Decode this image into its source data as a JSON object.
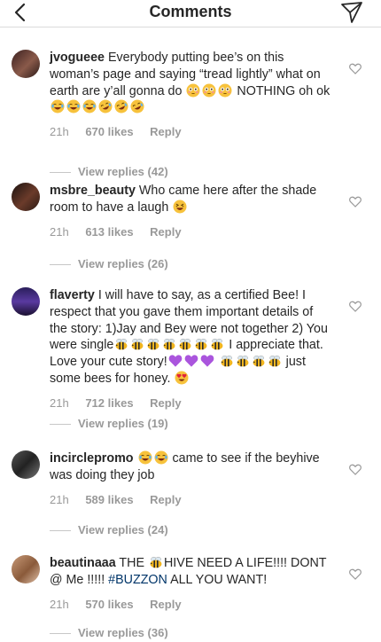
{
  "header": {
    "title": "Comments"
  },
  "comments": [
    {
      "username": "jvogueee",
      "segments": [
        {
          "t": "text",
          "v": " Everybody putting bee’s on this woman’s page and saying “tread lightly” what on earth are y’all gonna do "
        },
        {
          "t": "emoji",
          "v": "flushed"
        },
        {
          "t": "emoji",
          "v": "flushed"
        },
        {
          "t": "emoji",
          "v": "flushed"
        },
        {
          "t": "text",
          "v": " NOTHING oh ok "
        },
        {
          "t": "emoji",
          "v": "joy"
        },
        {
          "t": "emoji",
          "v": "joy"
        },
        {
          "t": "emoji",
          "v": "joy"
        },
        {
          "t": "emoji",
          "v": "rofl"
        },
        {
          "t": "emoji",
          "v": "rofl"
        },
        {
          "t": "emoji",
          "v": "rofl"
        }
      ],
      "time": "21h",
      "likes": "670 likes",
      "reply": "Reply",
      "view_replies": "View replies (42)"
    },
    {
      "username": "msbre_beauty",
      "segments": [
        {
          "t": "text",
          "v": " Who came here after the shade room to have a laugh "
        },
        {
          "t": "emoji",
          "v": "laughing"
        }
      ],
      "time": "21h",
      "likes": "613 likes",
      "reply": "Reply",
      "view_replies": "View replies (26)"
    },
    {
      "username": "flaverty",
      "segments": [
        {
          "t": "text",
          "v": " I will have to say, as a certified Bee! I respect that you gave them important details of the story: 1)Jay and Bey were not together 2) You were single"
        },
        {
          "t": "emoji",
          "v": "bee"
        },
        {
          "t": "emoji",
          "v": "bee"
        },
        {
          "t": "emoji",
          "v": "bee"
        },
        {
          "t": "emoji",
          "v": "bee"
        },
        {
          "t": "emoji",
          "v": "bee"
        },
        {
          "t": "emoji",
          "v": "bee"
        },
        {
          "t": "emoji",
          "v": "bee"
        },
        {
          "t": "text",
          "v": " I appreciate that. Love your cute story!"
        },
        {
          "t": "emoji",
          "v": "purple-heart"
        },
        {
          "t": "emoji",
          "v": "purple-heart"
        },
        {
          "t": "emoji",
          "v": "purple-heart"
        },
        {
          "t": "text",
          "v": " "
        },
        {
          "t": "emoji",
          "v": "bee"
        },
        {
          "t": "emoji",
          "v": "bee"
        },
        {
          "t": "emoji",
          "v": "bee"
        },
        {
          "t": "emoji",
          "v": "bee"
        },
        {
          "t": "text",
          "v": " just some bees for honey. "
        },
        {
          "t": "emoji",
          "v": "heart-eyes"
        }
      ],
      "time": "21h",
      "likes": "712 likes",
      "reply": "Reply",
      "view_replies": "View replies (19)"
    },
    {
      "username": "incirclepromo",
      "segments": [
        {
          "t": "text",
          "v": " "
        },
        {
          "t": "emoji",
          "v": "joy"
        },
        {
          "t": "emoji",
          "v": "joy"
        },
        {
          "t": "text",
          "v": " came to see if the beyhive was doing they job"
        }
      ],
      "time": "21h",
      "likes": "589 likes",
      "reply": "Reply",
      "view_replies": "View replies (24)"
    },
    {
      "username": "beautinaaa",
      "segments": [
        {
          "t": "text",
          "v": " THE "
        },
        {
          "t": "emoji",
          "v": "bee"
        },
        {
          "t": "text",
          "v": "HIVE NEED A LIFE!!!! DONT @ Me !!!!! "
        },
        {
          "t": "tag",
          "v": "#BUZZON"
        },
        {
          "t": "text",
          "v": " ALL YOU WANT!"
        }
      ],
      "time": "21h",
      "likes": "570 likes",
      "reply": "Reply",
      "view_replies": "View replies (36)"
    }
  ]
}
